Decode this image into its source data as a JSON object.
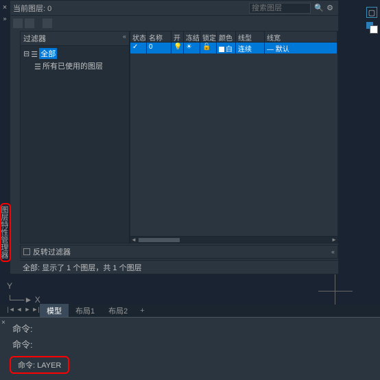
{
  "titlebar": {
    "current_layer_label": "当前图层:  0",
    "search_placeholder": "搜索图层"
  },
  "vertical_panel_label": "图层特性管理器",
  "filter": {
    "header": "过滤器",
    "collapse": "«",
    "tree_root": "全部",
    "tree_child": "所有已使用的图层",
    "invert_label": "反转过滤器"
  },
  "list": {
    "headers": {
      "status": "状态",
      "name": "名称",
      "on": "开",
      "freeze": "冻结",
      "lock": "锁定",
      "color": "颜色",
      "ltype": "线型",
      "lw": "线宽"
    },
    "row0": {
      "name": "0",
      "color": "白",
      "ltype": "连续",
      "lw": "— 默认"
    }
  },
  "status_text": "全部: 显示了 1 个图层，共 1 个图层",
  "ucs": {
    "y": "Y",
    "x": "X"
  },
  "tabs": {
    "model": "模型",
    "layout1": "布局1",
    "layout2": "布局2",
    "plus": "+"
  },
  "cmd": {
    "line1": "命令:",
    "line2": "命令:",
    "layer_cmd": "命令: LAYER"
  }
}
